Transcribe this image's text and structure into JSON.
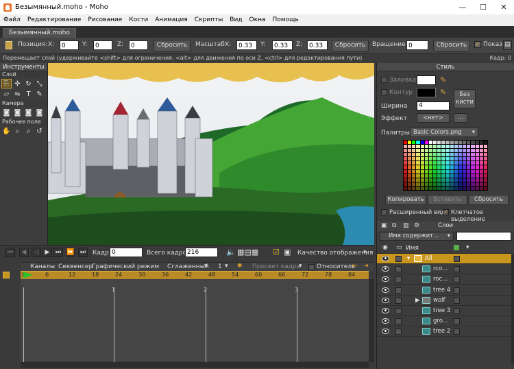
{
  "window": {
    "title": "Безымянный.moho - Moho",
    "minimize": "—",
    "maximize": "☐",
    "close": "✕"
  },
  "menu": [
    "Файл",
    "Редактирование",
    "Рисование",
    "Кости",
    "Анимация",
    "Скрипты",
    "Вид",
    "Окна",
    "Помощь"
  ],
  "tab": {
    "label": "Безымянный.moho"
  },
  "tool_options": {
    "position_label": "Позиция:",
    "x_label": "X:",
    "x_value": "0",
    "y_label": "Y:",
    "y_value": "0",
    "z_label": "Z:",
    "z_value": "0",
    "reset1": "Сбросить",
    "scale_label": "Масштаб:",
    "sx_label": "X:",
    "sx_value": "0.33",
    "sy_label": "Y:",
    "sy_value": "0.33",
    "sz_label": "Z:",
    "sz_value": "0.33",
    "reset2": "Сбросить",
    "rotation_label": "Вращение",
    "rotation_value": "0",
    "reset3": "Сбросить",
    "show_label": "Показ"
  },
  "hint": {
    "text": "Перемещает слой (удерживайте <shift> для ограничения, <alt> для движения по оси Z, <ctrl> для редактирования пути)",
    "frame": "Кадр: 0"
  },
  "tools": {
    "title": "Инструменты",
    "layer": "Слой",
    "camera": "Камера",
    "workspace": "Рабочее поле"
  },
  "style": {
    "title": "Стиль",
    "fill": "Заливка",
    "stroke": "Контур",
    "width_label": "Ширина",
    "width_value": "4",
    "no_brush": "Без кисти",
    "effect_label": "Эффект",
    "effect_value": "<нет>",
    "more": "...",
    "palettes_label": "Палитры",
    "palette_value": "Basic Colors.png",
    "copy": "Копировать",
    "paste": "Вставить",
    "reset": "Сбросить",
    "extended": "Расширенный вид",
    "checker": "Клетчатое выделение",
    "fill_color": "#ffffff",
    "stroke_color": "#000000"
  },
  "layers": {
    "title": "Слои",
    "filter": "Имя содержит...",
    "name_header": "Имя",
    "items": [
      {
        "name": "All",
        "selected": true
      },
      {
        "name": "rco...",
        "selected": false
      },
      {
        "name": "roc...",
        "selected": false
      },
      {
        "name": "tree 4",
        "selected": false
      },
      {
        "name": "wolf",
        "selected": false
      },
      {
        "name": "tree 3",
        "selected": false
      },
      {
        "name": "gro...",
        "selected": false
      },
      {
        "name": "tree 2",
        "selected": false
      }
    ]
  },
  "timeline": {
    "frame_label": "Кадр:",
    "frame_value": "0",
    "total_label": "Всего кадров:",
    "total_value": "216",
    "quality": "Качество отображения",
    "tabs": [
      "Каналы",
      "Секвенсер",
      "Графический режим"
    ],
    "smooth": "Сглаженный",
    "one": "1",
    "onion": "Просвет кадра",
    "relative": "Относитель",
    "ticks": [
      "0",
      "6",
      "12",
      "18",
      "24",
      "30",
      "36",
      "42",
      "48",
      "54",
      "60",
      "66",
      "72",
      "78",
      "84"
    ],
    "marks": [
      "1",
      "2",
      "3"
    ]
  },
  "accent": "#c8951d"
}
